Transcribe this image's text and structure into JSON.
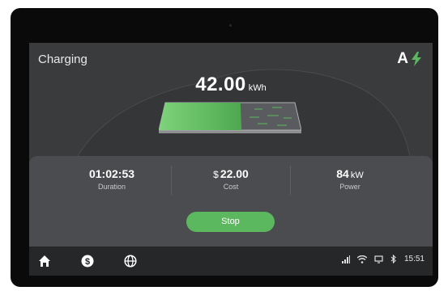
{
  "status": {
    "title": "Charging",
    "brand_letter": "A"
  },
  "energy": {
    "value": "42.00",
    "unit": "kWh",
    "battery_fill_fraction": 0.58
  },
  "stats": {
    "duration": {
      "value": "01:02:53",
      "label": "Duration"
    },
    "cost": {
      "currency": "$",
      "value": "22.00",
      "label": "Cost"
    },
    "power": {
      "value": "84",
      "unit": "kW",
      "label": "Power"
    }
  },
  "actions": {
    "stop_label": "Stop"
  },
  "nav": {
    "icons": [
      "home-icon",
      "dollar-icon",
      "globe-icon"
    ]
  },
  "system": {
    "icons": [
      "signal-icon",
      "wifi-icon",
      "cast-icon",
      "bluetooth-icon"
    ],
    "time": "15:51"
  },
  "colors": {
    "accent": "#5cb85f",
    "screen": "#3a3b3d",
    "panel": "#4b4c4f",
    "nav": "#262729"
  }
}
